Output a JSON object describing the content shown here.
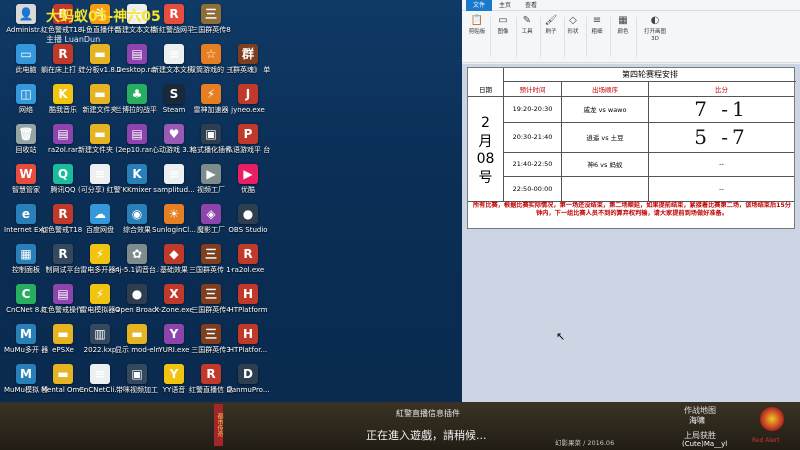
{
  "desktop_icons": [
    {
      "label": "Administr...",
      "color": "#d9d9d9",
      "glyph": "👤",
      "col": 0,
      "row": 0
    },
    {
      "label": "红色警戒T18 战队-直播...",
      "color": "#c0392b",
      "glyph": "R",
      "col": 1,
      "row": 0
    },
    {
      "label": "斗鱼直播伴侣",
      "color": "#f39c12",
      "glyph": "斗",
      "col": 2,
      "row": 0
    },
    {
      "label": "新建文本文档 (4).txt",
      "color": "#ecf0f1",
      "glyph": "≡",
      "col": 3,
      "row": 0
    },
    {
      "label": "新红警战网平 台测试版",
      "color": "#e74c3c",
      "glyph": "R",
      "col": 4,
      "row": 0
    },
    {
      "label": "三国群英传8",
      "color": "#8e6d3a",
      "glyph": "三",
      "col": 5,
      "row": 0
    },
    {
      "label": "此电脑",
      "color": "#3498db",
      "glyph": "▭",
      "col": 0,
      "row": 1
    },
    {
      "label": "躺在床上打 红警-直播...",
      "color": "#c0392b",
      "glyph": "R",
      "col": 1,
      "row": 1
    },
    {
      "label": "计分板v1.8.1",
      "color": "#e6b422",
      "glyph": "▬",
      "col": 2,
      "row": 1
    },
    {
      "label": "Desktop.rar",
      "color": "#8e44ad",
      "glyph": "▤",
      "col": 3,
      "row": 1
    },
    {
      "label": "新建文本文档 (2).txt",
      "color": "#ecf0f1",
      "glyph": "≡",
      "col": 4,
      "row": 1
    },
    {
      "label": "双筒游戏的 三国",
      "color": "#e67e22",
      "glyph": "☆",
      "col": 5,
      "row": 1
    },
    {
      "label": "《群英魂》 单机版",
      "color": "#7f3f1f",
      "glyph": "群",
      "col": 6,
      "row": 1
    },
    {
      "label": "网络",
      "color": "#3498db",
      "glyph": "◫",
      "col": 0,
      "row": 2
    },
    {
      "label": "酷我音乐",
      "color": "#f1c40f",
      "glyph": "K",
      "col": 1,
      "row": 2
    },
    {
      "label": "新建文件夹",
      "color": "#e6b422",
      "glyph": "▬",
      "col": 2,
      "row": 2
    },
    {
      "label": "兰博拉的战平 台",
      "color": "#27ae60",
      "glyph": "♣",
      "col": 3,
      "row": 2
    },
    {
      "label": "Steam",
      "color": "#1b2838",
      "glyph": "S",
      "col": 4,
      "row": 2
    },
    {
      "label": "雷神加速器",
      "color": "#e67e22",
      "glyph": "⚡",
      "col": 5,
      "row": 2
    },
    {
      "label": "jyneo.exe",
      "color": "#c0392b",
      "glyph": "J",
      "col": 6,
      "row": 2
    },
    {
      "label": "回收站",
      "color": "#95a5a6",
      "glyph": "🗑",
      "col": 0,
      "row": 3
    },
    {
      "label": "ra2ol.rar",
      "color": "#8e44ad",
      "glyph": "▤",
      "col": 1,
      "row": 3
    },
    {
      "label": "新建文件夹 (2)",
      "color": "#e6b422",
      "glyph": "▬",
      "col": 2,
      "row": 3
    },
    {
      "label": "ep10.rar",
      "color": "#8e44ad",
      "glyph": "▤",
      "col": 3,
      "row": 3
    },
    {
      "label": "心动游戏 3.3.2客户端",
      "color": "#9b59b6",
      "glyph": "♥",
      "col": 4,
      "row": 3
    },
    {
      "label": "格式播化插件",
      "color": "#2c3e50",
      "glyph": "▣",
      "col": 5,
      "row": 3
    },
    {
      "label": "私语游戏平 台",
      "color": "#c0392b",
      "glyph": "P",
      "col": 6,
      "row": 3
    },
    {
      "label": "智慧管家",
      "color": "#e74c3c",
      "glyph": "W",
      "col": 0,
      "row": 4
    },
    {
      "label": "腾讯QQ",
      "color": "#1abc9c",
      "glyph": "Q",
      "col": 1,
      "row": 4
    },
    {
      "label": "(可分享) 红警T18战队-...",
      "color": "#ecf0f1",
      "glyph": "≡",
      "col": 2,
      "row": 4
    },
    {
      "label": "KKmixer",
      "color": "#2980b9",
      "glyph": "K",
      "col": 3,
      "row": 4
    },
    {
      "label": "samplitud...",
      "color": "#ecf0f1",
      "glyph": "≡",
      "col": 4,
      "row": 4
    },
    {
      "label": "视频工厂",
      "color": "#7f8c8d",
      "glyph": "▶",
      "col": 5,
      "row": 4
    },
    {
      "label": "优酷",
      "color": "#e91e63",
      "glyph": "▶",
      "col": 6,
      "row": 4
    },
    {
      "label": "Internet Explorer",
      "color": "#2980b9",
      "glyph": "e",
      "col": 0,
      "row": 5
    },
    {
      "label": "红色警戒T18 战队-直播...",
      "color": "#c0392b",
      "glyph": "R",
      "col": 1,
      "row": 5
    },
    {
      "label": "百度网盘",
      "color": "#3498db",
      "glyph": "☁",
      "col": 2,
      "row": 5
    },
    {
      "label": "综合效果",
      "color": "#2980b9",
      "glyph": "◉",
      "col": 3,
      "row": 5
    },
    {
      "label": "SunloginCl...",
      "color": "#e67e22",
      "glyph": "☀",
      "col": 4,
      "row": 5
    },
    {
      "label": "魔影工厂",
      "color": "#8e44ad",
      "glyph": "◈",
      "col": 5,
      "row": 5
    },
    {
      "label": "OBS Studio",
      "color": "#2c3e50",
      "glyph": "●",
      "col": 6,
      "row": 5
    },
    {
      "label": "控制面板",
      "color": "#2980b9",
      "glyph": "▦",
      "col": 0,
      "row": 6
    },
    {
      "label": "制网试平台",
      "color": "#34495e",
      "glyph": "R",
      "col": 1,
      "row": 6
    },
    {
      "label": "雷电多开器4",
      "color": "#f1c40f",
      "glyph": "⚡",
      "col": 2,
      "row": 6
    },
    {
      "label": "nj-5.1调音台.kx",
      "color": "#7f8c8d",
      "glyph": "✿",
      "col": 3,
      "row": 6
    },
    {
      "label": "基础效果",
      "color": "#c0392b",
      "glyph": "◆",
      "col": 4,
      "row": 6
    },
    {
      "label": "三国群英传 1-7窗口化...",
      "color": "#7f3f1f",
      "glyph": "三",
      "col": 5,
      "row": 6
    },
    {
      "label": "ra2ol.exe",
      "color": "#c0392b",
      "glyph": "R",
      "col": 6,
      "row": 6
    },
    {
      "label": "CnCNet 8.2",
      "color": "#27ae60",
      "glyph": "C",
      "col": 0,
      "row": 7
    },
    {
      "label": "红色警戒操作 (战网).rar",
      "color": "#8e44ad",
      "glyph": "▤",
      "col": 1,
      "row": 7
    },
    {
      "label": "雷电模拟器4",
      "color": "#f1c40f",
      "glyph": "⚡",
      "col": 2,
      "row": 7
    },
    {
      "label": "Open Broadcast...",
      "color": "#2c3e50",
      "glyph": "●",
      "col": 3,
      "row": 7
    },
    {
      "label": "X-Zone.exe",
      "color": "#c0392b",
      "glyph": "X",
      "col": 4,
      "row": 7
    },
    {
      "label": "三国群英传4",
      "color": "#7f3f1f",
      "glyph": "三",
      "col": 5,
      "row": 7
    },
    {
      "label": "HTPlatform",
      "color": "#c0392b",
      "glyph": "H",
      "col": 6,
      "row": 7
    },
    {
      "label": "MuMu多开 器",
      "color": "#2980b9",
      "glyph": "M",
      "col": 0,
      "row": 8
    },
    {
      "label": "ePSXe",
      "color": "#e6b422",
      "glyph": "▬",
      "col": 1,
      "row": 8
    },
    {
      "label": "2022.kxp",
      "color": "#34495e",
      "glyph": "▥",
      "col": 2,
      "row": 8
    },
    {
      "label": "显示 mod-elma...",
      "color": "#e6b422",
      "glyph": "▬",
      "col": 3,
      "row": 8
    },
    {
      "label": "YURI.exe",
      "color": "#8e44ad",
      "glyph": "Y",
      "col": 4,
      "row": 8
    },
    {
      "label": "三国群英传3",
      "color": "#7f3f1f",
      "glyph": "三",
      "col": 5,
      "row": 8
    },
    {
      "label": "HTPlatfor...",
      "color": "#c0392b",
      "glyph": "H",
      "col": 6,
      "row": 8
    },
    {
      "label": "MuMu模拟 器",
      "color": "#2980b9",
      "glyph": "M",
      "col": 0,
      "row": 9
    },
    {
      "label": "Mental Omega",
      "color": "#e6b422",
      "glyph": "▬",
      "col": 1,
      "row": 9
    },
    {
      "label": "CnCNetCli...",
      "color": "#ecf0f1",
      "glyph": "≡",
      "col": 2,
      "row": 9
    },
    {
      "label": "带咪视频加工",
      "color": "#34495e",
      "glyph": "▣",
      "col": 3,
      "row": 9
    },
    {
      "label": "YY语音",
      "color": "#f1c40f",
      "glyph": "Y",
      "col": 4,
      "row": 9
    },
    {
      "label": "红警直播信 息插件",
      "color": "#c0392b",
      "glyph": "R",
      "col": 5,
      "row": 9
    },
    {
      "label": "DanmuPro...",
      "color": "#2c3e50",
      "glyph": "D",
      "col": 6,
      "row": 9
    }
  ],
  "paint": {
    "tabs": [
      "文件",
      "主页",
      "查看"
    ],
    "tools": [
      {
        "label": "剪贴板",
        "icon": "clipboard-icon",
        "glyph": "📋"
      },
      {
        "label": "图像",
        "icon": "image-icon",
        "glyph": "▭"
      },
      {
        "label": "工具",
        "icon": "pencil-icon",
        "glyph": "✎"
      },
      {
        "label": "刷子",
        "icon": "brush-icon",
        "glyph": "🖌"
      },
      {
        "label": "形状",
        "icon": "shapes-icon",
        "glyph": "◇"
      },
      {
        "label": "粗细",
        "icon": "line-width-icon",
        "glyph": "≡"
      },
      {
        "label": "颜色",
        "icon": "palette-icon",
        "glyph": "▦"
      },
      {
        "label": "打开画图 3D",
        "icon": "paint3d-icon",
        "glyph": "◐"
      }
    ]
  },
  "schedule": {
    "title": "第四轮赛程安排",
    "headers": {
      "date": "日期",
      "time": "预计时间",
      "order": "出场顺序",
      "score": "比分"
    },
    "date_chars": [
      "2",
      "月",
      "08",
      "号"
    ],
    "rows": [
      {
        "time": "19:20-20:30",
        "match": "戚龙 vs wawo",
        "score": "7 -1"
      },
      {
        "time": "20:30-21:40",
        "match": "逍遥 vs 土豆",
        "score": "5 -7"
      },
      {
        "time": "21:40-22:50",
        "match": "神6 vs 蚂蚁",
        "score": "--"
      },
      {
        "time": "22:50-00:00",
        "match": "",
        "score": "--"
      }
    ],
    "notice": "所有比赛，根据比赛实际情况，第一场还没结束，第二场顺延，如果提前结束，紧接着比赛第二场，该场结束后15分钟内，下一组比赛人员不到的算弃权判输，请大家提前到场做好准备。"
  },
  "bottom": {
    "match_title": "大蚂蚁05-神六05",
    "host": "主播  LuanDun",
    "ribbon": "都市传奇",
    "plugin_title": "紅警直播信息插件",
    "status": "正在進入遊戲，請稍候...",
    "footer": "幻影果菜  /  2016.06",
    "map_label": "作战地图",
    "map_name": "海啸",
    "last_winner_label": "上局获胜",
    "last_winner": "(Cute)Ma__yl",
    "logo_text": "Red Alert"
  }
}
